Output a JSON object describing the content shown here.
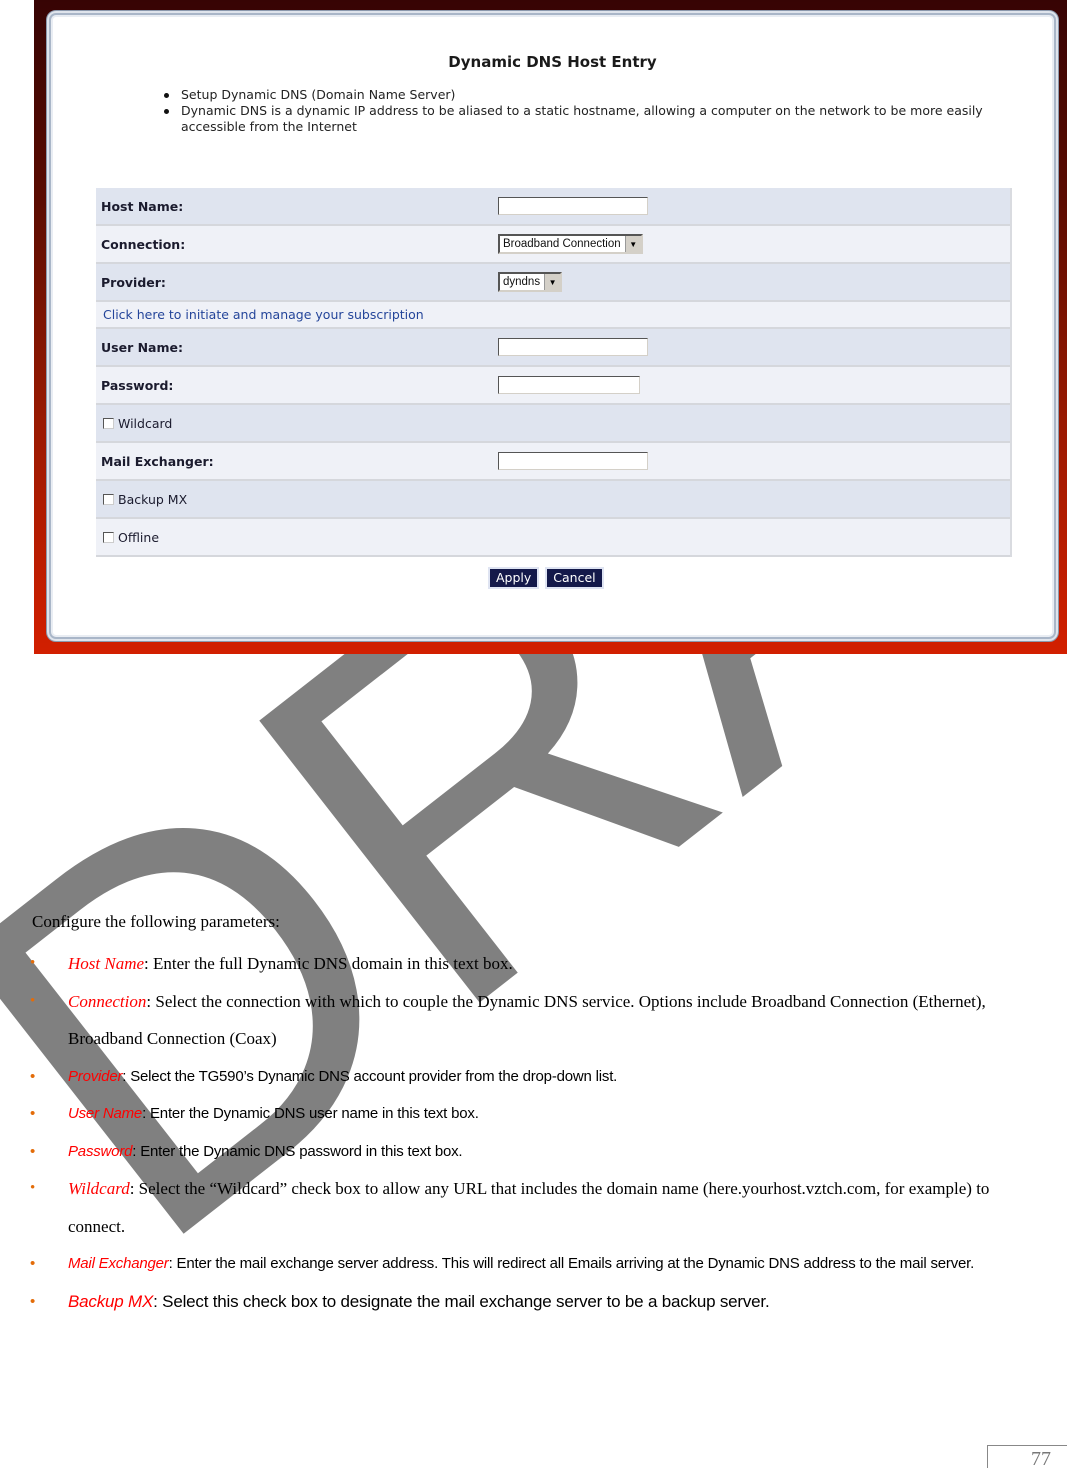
{
  "screenshot": {
    "title": "Dynamic DNS Host Entry",
    "bullets": [
      "Setup Dynamic DNS (Domain Name Server)",
      "Dynamic DNS is a dynamic IP address to be aliased to a static hostname, allowing a computer on the network to be more easily accessible from the Internet"
    ],
    "form": {
      "host_name_label": "Host Name:",
      "host_name_value": "",
      "connection_label": "Connection:",
      "connection_value": "Broadband Connection",
      "provider_label": "Provider:",
      "provider_value": "dyndns",
      "subscription_link": "Click here to initiate and manage your subscription",
      "user_name_label": "User Name:",
      "user_name_value": "",
      "password_label": "Password:",
      "password_value": "",
      "wildcard_label": "Wildcard",
      "wildcard_checked": false,
      "mail_exchanger_label": "Mail Exchanger:",
      "mail_exchanger_value": "",
      "backup_mx_label": "Backup MX",
      "backup_mx_checked": false,
      "offline_label": "Offline",
      "offline_checked": false
    },
    "buttons": {
      "apply": "Apply",
      "cancel": "Cancel"
    },
    "colors": {
      "row_dark": "#dfe4ef",
      "row_light": "#eff1f7",
      "button": "#14194a",
      "link": "#24459a"
    }
  },
  "document": {
    "intro": "Configure the following parameters:",
    "params": [
      {
        "term": "Host Name",
        "desc": ": Enter the full Dynamic DNS domain in this text box."
      },
      {
        "term": "Connection",
        "desc": ": Select the connection with which to couple the Dynamic DNS service. Options include Broadband Connection (Ethernet), Broadband Connection (Coax)"
      },
      {
        "term": "Provider",
        "desc": ": Select the TG590’s Dynamic DNS account provider from the drop-down list."
      },
      {
        "term": "User Name",
        "desc": ": Enter the Dynamic DNS user name in this text box."
      },
      {
        "term": "Password",
        "desc": ": Enter the Dynamic DNS password in this text box."
      },
      {
        "term": "Wildcard",
        "desc": ": Select the “Wildcard” check box to allow any URL that includes the domain name (here.yourhost.vztch.com, for example) to connect."
      },
      {
        "term": "Mail Exchanger",
        "desc": ":  Enter the mail exchange server address. This will redirect all Emails arriving at the Dynamic DNS address to the mail server."
      },
      {
        "term": "Backup MX",
        "desc": ": Select this check box to designate the mail exchange server to be a backup server."
      }
    ],
    "watermark": "DRAFT",
    "page_number": "77",
    "colors": {
      "term": "#ff0000",
      "bullet": "#e36c09",
      "watermark": "#808080"
    }
  }
}
